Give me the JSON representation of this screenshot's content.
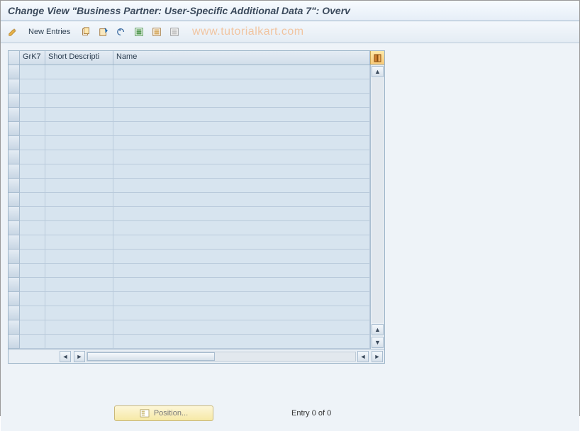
{
  "title": "Change View \"Business Partner: User-Specific Additional Data 7\": Overv",
  "watermark": "www.tutorialkart.com",
  "toolbar": {
    "new_entries": "New Entries"
  },
  "grid": {
    "columns": {
      "grk7": "GrK7",
      "short_desc": "Short Descripti",
      "name": "Name"
    },
    "row_count": 20
  },
  "footer": {
    "position_label": "Position...",
    "entry_text": "Entry 0 of 0"
  }
}
